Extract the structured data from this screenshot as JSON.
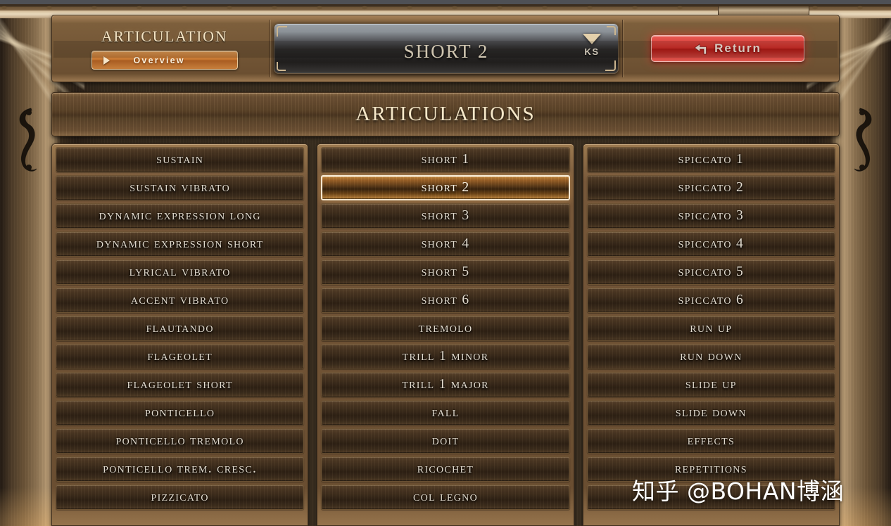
{
  "header": {
    "panel_title": "Articulation",
    "overview_button": "Overview",
    "overview_icon": "play-triangle-icon",
    "selector": {
      "value": "Short 2",
      "badge": "KS",
      "chevron_icon": "chevron-down-icon"
    },
    "return_button": {
      "label": "Return",
      "icon": "return-arrow-icon",
      "color": "#d8322c"
    }
  },
  "section": {
    "title": "Articulations"
  },
  "colors": {
    "wood_frame": "#6b4f31",
    "row_bg": "#3a2a1a",
    "selected_accent": "#c78a3e",
    "selected_border": "#f3e6d0",
    "text": "#e4ddd0",
    "heading_text": "#f5e7c8",
    "return_red": "#d8322c",
    "overview_orange": "#c4742f"
  },
  "selected_articulation": "Short 2",
  "columns": [
    {
      "name": "column-1",
      "items": [
        "Sustain",
        "Sustain Vibrato",
        "Dynamic Expression Long",
        "Dynamic Expression Short",
        "Lyrical Vibrato",
        "Accent Vibrato",
        "Flautando",
        "Flageolet",
        "Flageolet Short",
        "Ponticello",
        "Ponticello Tremolo",
        "Ponticello Trem. Cresc.",
        "Pizzicato"
      ]
    },
    {
      "name": "column-2",
      "items": [
        "Short 1",
        "Short 2",
        "Short 3",
        "Short 4",
        "Short 5",
        "Short 6",
        "Tremolo",
        "Trill 1 Minor",
        "Trill 1 Major",
        "Fall",
        "Doit",
        "Ricochet",
        "Col Legno"
      ]
    },
    {
      "name": "column-3",
      "items": [
        "Spiccato 1",
        "Spiccato 2",
        "Spiccato 3",
        "Spiccato 4",
        "Spiccato 5",
        "Spiccato 6",
        "Run Up",
        "Run Down",
        "Slide Up",
        "Slide Down",
        "Effects",
        "Repetitions",
        ""
      ]
    }
  ],
  "watermark": "知乎 @BOHAN博涵"
}
